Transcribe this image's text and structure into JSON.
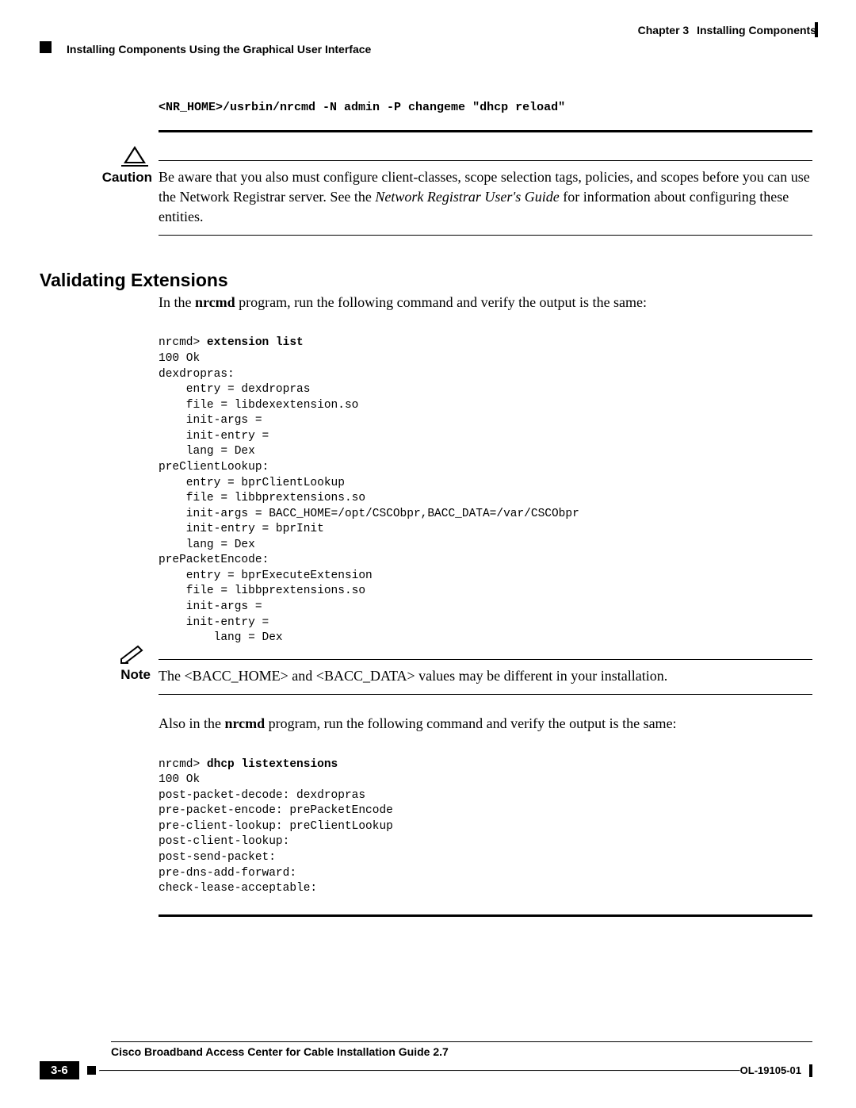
{
  "header": {
    "chapter_label": "Chapter 3",
    "chapter_title": "Installing Components",
    "breadcrumb": "Installing Components Using the Graphical User Interface"
  },
  "command1": "<NR_HOME>/usrbin/nrcmd -N admin -P changeme \"dhcp reload\"",
  "caution": {
    "label": "Caution",
    "text_pre": "Be aware that you also must configure client-classes, scope selection tags, policies, and scopes before you can use the Network Registrar server. See the ",
    "text_ital": "Network Registrar User's Guide",
    "text_post": " for information about configuring these entities."
  },
  "section_heading": "Validating Extensions",
  "para1_pre": "In the ",
  "para1_bold": "nrcmd",
  "para1_post": " program, run the following command and verify the output is the same:",
  "code1_prompt": "nrcmd> ",
  "code1_cmd": "extension list",
  "code1_body": "100 Ok\ndexdropras:\n    entry = dexdropras\n    file = libdexextension.so\n    init-args = \n    init-entry = \n    lang = Dex\npreClientLookup:\n    entry = bprClientLookup\n    file = libbprextensions.so\n    init-args = BACC_HOME=/opt/CSCObpr,BACC_DATA=/var/CSCObpr\n    init-entry = bprInit\n    lang = Dex\nprePacketEncode:\n    entry = bprExecuteExtension\n    file = libbprextensions.so\n    init-args = \n    init-entry = \n        lang = Dex",
  "note": {
    "label": "Note",
    "text": "The <BACC_HOME> and <BACC_DATA> values may be different in your installation."
  },
  "para2_pre": "Also in the ",
  "para2_bold": "nrcmd",
  "para2_post": " program, run the following command and verify the output is the same:",
  "code2_prompt": "nrcmd> ",
  "code2_cmd": "dhcp listextensions",
  "code2_body": "100 Ok\npost-packet-decode: dexdropras\npre-packet-encode: prePacketEncode\npre-client-lookup: preClientLookup\npost-client-lookup: \npost-send-packet: \npre-dns-add-forward: \ncheck-lease-acceptable: ",
  "footer": {
    "book_title": "Cisco Broadband Access Center for Cable Installation Guide 2.7",
    "page_number": "3-6",
    "doc_id": "OL-19105-01"
  }
}
